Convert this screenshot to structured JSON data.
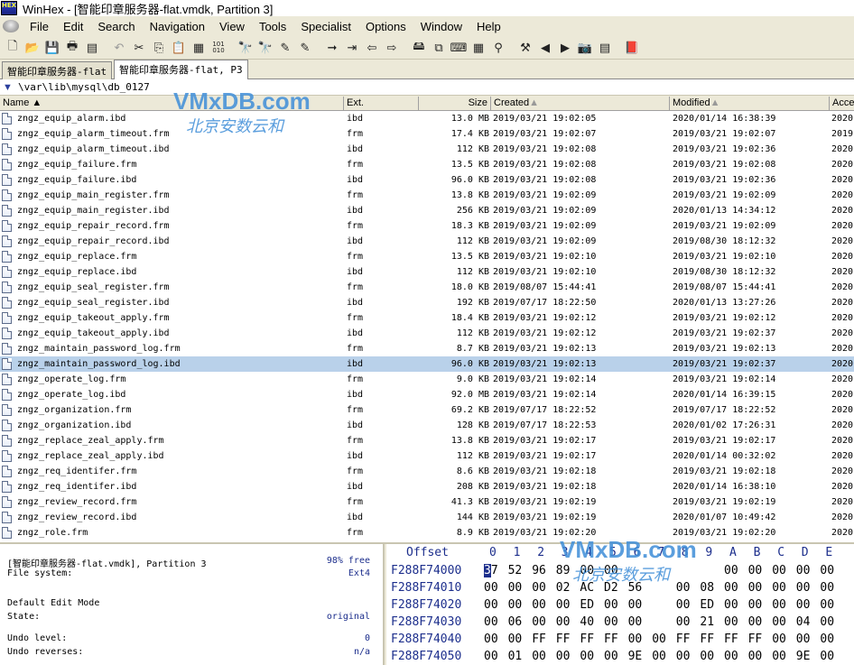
{
  "window": {
    "app_icon_text": "HEX",
    "title": "WinHex - [智能印章服务器-flat.vmdk, Partition 3]"
  },
  "menu": [
    "File",
    "Edit",
    "Search",
    "Navigation",
    "View",
    "Tools",
    "Specialist",
    "Options",
    "Window",
    "Help"
  ],
  "tabs": [
    {
      "label": "智能印章服务器-flat"
    },
    {
      "label": "智能印章服务器-flat, P3"
    }
  ],
  "path": "\\var\\lib\\mysql\\db_0127",
  "columns": {
    "name": "Name",
    "ext": "Ext.",
    "size": "Size",
    "created": "Created",
    "modified": "Modified",
    "accessed": "Acce"
  },
  "files": [
    {
      "name": "zngz_equip_alarm.ibd",
      "ext": "ibd",
      "size": "13.0 MB",
      "created": "2019/03/21   19:02:05",
      "modified": "2020/01/14   16:38:39",
      "accessed": "2020"
    },
    {
      "name": "zngz_equip_alarm_timeout.frm",
      "ext": "frm",
      "size": "17.4 KB",
      "created": "2019/03/21   19:02:07",
      "modified": "2019/03/21   19:02:07",
      "accessed": "2019"
    },
    {
      "name": "zngz_equip_alarm_timeout.ibd",
      "ext": "ibd",
      "size": "112 KB",
      "created": "2019/03/21   19:02:08",
      "modified": "2019/03/21   19:02:36",
      "accessed": "2020"
    },
    {
      "name": "zngz_equip_failure.frm",
      "ext": "frm",
      "size": "13.5 KB",
      "created": "2019/03/21   19:02:08",
      "modified": "2019/03/21   19:02:08",
      "accessed": "2020"
    },
    {
      "name": "zngz_equip_failure.ibd",
      "ext": "ibd",
      "size": "96.0 KB",
      "created": "2019/03/21   19:02:08",
      "modified": "2019/03/21   19:02:36",
      "accessed": "2020"
    },
    {
      "name": "zngz_equip_main_register.frm",
      "ext": "frm",
      "size": "13.8 KB",
      "created": "2019/03/21   19:02:09",
      "modified": "2019/03/21   19:02:09",
      "accessed": "2020"
    },
    {
      "name": "zngz_equip_main_register.ibd",
      "ext": "ibd",
      "size": "256 KB",
      "created": "2019/03/21   19:02:09",
      "modified": "2020/01/13   14:34:12",
      "accessed": "2020"
    },
    {
      "name": "zngz_equip_repair_record.frm",
      "ext": "frm",
      "size": "18.3 KB",
      "created": "2019/03/21   19:02:09",
      "modified": "2019/03/21   19:02:09",
      "accessed": "2020"
    },
    {
      "name": "zngz_equip_repair_record.ibd",
      "ext": "ibd",
      "size": "112 KB",
      "created": "2019/03/21   19:02:09",
      "modified": "2019/08/30   18:12:32",
      "accessed": "2020"
    },
    {
      "name": "zngz_equip_replace.frm",
      "ext": "frm",
      "size": "13.5 KB",
      "created": "2019/03/21   19:02:10",
      "modified": "2019/03/21   19:02:10",
      "accessed": "2020"
    },
    {
      "name": "zngz_equip_replace.ibd",
      "ext": "ibd",
      "size": "112 KB",
      "created": "2019/03/21   19:02:10",
      "modified": "2019/08/30   18:12:32",
      "accessed": "2020"
    },
    {
      "name": "zngz_equip_seal_register.frm",
      "ext": "frm",
      "size": "18.0 KB",
      "created": "2019/08/07   15:44:41",
      "modified": "2019/08/07   15:44:41",
      "accessed": "2020"
    },
    {
      "name": "zngz_equip_seal_register.ibd",
      "ext": "ibd",
      "size": "192 KB",
      "created": "2019/07/17   18:22:50",
      "modified": "2020/01/13   13:27:26",
      "accessed": "2020"
    },
    {
      "name": "zngz_equip_takeout_apply.frm",
      "ext": "frm",
      "size": "18.4 KB",
      "created": "2019/03/21   19:02:12",
      "modified": "2019/03/21   19:02:12",
      "accessed": "2020"
    },
    {
      "name": "zngz_equip_takeout_apply.ibd",
      "ext": "ibd",
      "size": "112 KB",
      "created": "2019/03/21   19:02:12",
      "modified": "2019/03/21   19:02:37",
      "accessed": "2020"
    },
    {
      "name": "zngz_maintain_password_log.frm",
      "ext": "frm",
      "size": "8.7 KB",
      "created": "2019/03/21   19:02:13",
      "modified": "2019/03/21   19:02:13",
      "accessed": "2020"
    },
    {
      "name": "zngz_maintain_password_log.ibd",
      "ext": "ibd",
      "size": "96.0 KB",
      "created": "2019/03/21   19:02:13",
      "modified": "2019/03/21   19:02:37",
      "accessed": "2020",
      "selected": true
    },
    {
      "name": "zngz_operate_log.frm",
      "ext": "frm",
      "size": "9.0 KB",
      "created": "2019/03/21   19:02:14",
      "modified": "2019/03/21   19:02:14",
      "accessed": "2020"
    },
    {
      "name": "zngz_operate_log.ibd",
      "ext": "ibd",
      "size": "92.0 MB",
      "created": "2019/03/21   19:02:14",
      "modified": "2020/01/14   16:39:15",
      "accessed": "2020"
    },
    {
      "name": "zngz_organization.frm",
      "ext": "frm",
      "size": "69.2 KB",
      "created": "2019/07/17   18:22:52",
      "modified": "2019/07/17   18:22:52",
      "accessed": "2020"
    },
    {
      "name": "zngz_organization.ibd",
      "ext": "ibd",
      "size": "128 KB",
      "created": "2019/07/17   18:22:53",
      "modified": "2020/01/02   17:26:31",
      "accessed": "2020"
    },
    {
      "name": "zngz_replace_zeal_apply.frm",
      "ext": "frm",
      "size": "13.8 KB",
      "created": "2019/03/21   19:02:17",
      "modified": "2019/03/21   19:02:17",
      "accessed": "2020"
    },
    {
      "name": "zngz_replace_zeal_apply.ibd",
      "ext": "ibd",
      "size": "112 KB",
      "created": "2019/03/21   19:02:17",
      "modified": "2020/01/14   00:32:02",
      "accessed": "2020"
    },
    {
      "name": "zngz_req_identifer.frm",
      "ext": "frm",
      "size": "8.6 KB",
      "created": "2019/03/21   19:02:18",
      "modified": "2019/03/21   19:02:18",
      "accessed": "2020"
    },
    {
      "name": "zngz_req_identifer.ibd",
      "ext": "ibd",
      "size": "208 KB",
      "created": "2019/03/21   19:02:18",
      "modified": "2020/01/14   16:38:10",
      "accessed": "2020"
    },
    {
      "name": "zngz_review_record.frm",
      "ext": "frm",
      "size": "41.3 KB",
      "created": "2019/03/21   19:02:19",
      "modified": "2019/03/21   19:02:19",
      "accessed": "2020"
    },
    {
      "name": "zngz_review_record.ibd",
      "ext": "ibd",
      "size": "144 KB",
      "created": "2019/03/21   19:02:19",
      "modified": "2020/01/07   10:49:42",
      "accessed": "2020"
    },
    {
      "name": "zngz_role.frm",
      "ext": "frm",
      "size": "8.9 KB",
      "created": "2019/03/21   19:02:20",
      "modified": "2019/03/21   19:02:20",
      "accessed": "2020"
    }
  ],
  "info": {
    "volume_label": "[智能印章服务器-flat.vmdk], Partition 3",
    "free": "98% free",
    "fs_label": "File system:",
    "fs_value": "Ext4",
    "edit_mode_label": "Default Edit Mode",
    "state_label": "State:",
    "state_value": "original",
    "undo_level_label": "Undo level:",
    "undo_level_value": "0",
    "undo_reverses_label": "Undo reverses:",
    "undo_reverses_value": "n/a"
  },
  "hex": {
    "offset_label": "Offset",
    "columns": [
      "0",
      "1",
      "2",
      "3",
      "4",
      "5",
      "6",
      "7",
      "8",
      "9",
      "A",
      "B",
      "C",
      "D",
      "E"
    ],
    "rows": [
      {
        "offset": "F288F74000",
        "bytes": [
          "37",
          "52",
          "96",
          "89",
          "00",
          "00",
          "",
          "",
          "",
          "",
          "00",
          "00",
          "00",
          "00",
          "00"
        ]
      },
      {
        "offset": "F288F74010",
        "bytes": [
          "00",
          "00",
          "00",
          "02",
          "AC",
          "D2",
          "56",
          "",
          "00",
          "08",
          "00",
          "00",
          "00",
          "00",
          "00"
        ]
      },
      {
        "offset": "F288F74020",
        "bytes": [
          "00",
          "00",
          "00",
          "00",
          "ED",
          "00",
          "00",
          "",
          "00",
          "ED",
          "00",
          "00",
          "00",
          "00",
          "00"
        ]
      },
      {
        "offset": "F288F74030",
        "bytes": [
          "00",
          "06",
          "00",
          "00",
          "40",
          "00",
          "00",
          "",
          "00",
          "21",
          "00",
          "00",
          "00",
          "04",
          "00"
        ]
      },
      {
        "offset": "F288F74040",
        "bytes": [
          "00",
          "00",
          "FF",
          "FF",
          "FF",
          "FF",
          "00",
          "00",
          "FF",
          "FF",
          "FF",
          "FF",
          "00",
          "00",
          "00"
        ]
      },
      {
        "offset": "F288F74050",
        "bytes": [
          "00",
          "01",
          "00",
          "00",
          "00",
          "00",
          "9E",
          "00",
          "00",
          "00",
          "00",
          "00",
          "00",
          "9E",
          "00"
        ]
      }
    ]
  },
  "watermark": {
    "text": "VMxDB.com",
    "subtext": "北京安数云和"
  }
}
